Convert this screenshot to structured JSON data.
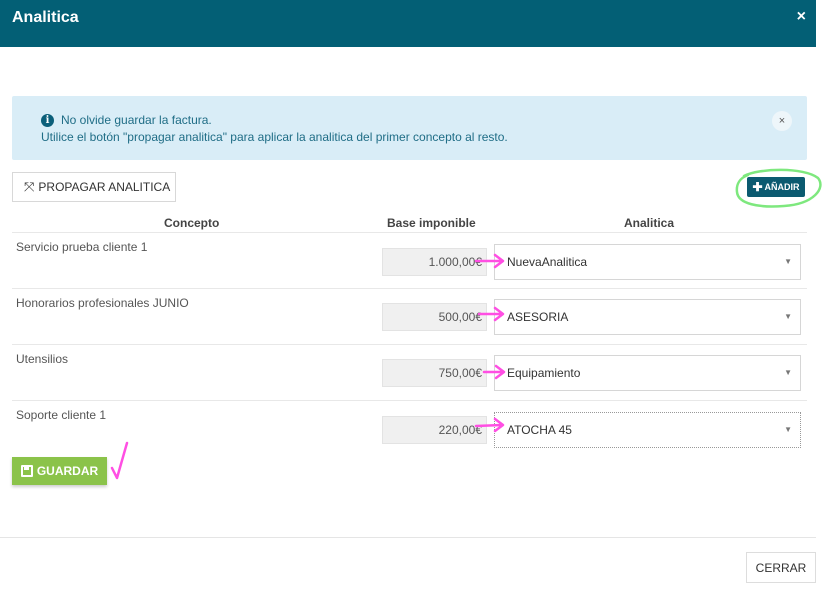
{
  "modal": {
    "title": "Analitica",
    "close_icon": "×"
  },
  "alert": {
    "line1": "No olvide guardar la factura.",
    "line2": "Utilice el botón \"propagar analitica\" para aplicar la analitica del primer concepto al resto.",
    "close_icon": "×"
  },
  "toolbar": {
    "propagar_label": "PROPAGAR ANALITICA",
    "anadir_label": "AÑADIR"
  },
  "table": {
    "headers": [
      "Concepto",
      "Base imponible",
      "Analitica"
    ],
    "rows": [
      {
        "concepto": "Servicio prueba cliente 1",
        "base": "1.000,00€",
        "analitica": "NuevaAnalitica"
      },
      {
        "concepto": "Honorarios profesionales JUNIO",
        "base": "500,00€",
        "analitica": "ASESORIA"
      },
      {
        "concepto": "Utensilios",
        "base": "750,00€",
        "analitica": "Equipamiento"
      },
      {
        "concepto": "Soporte cliente 1",
        "base": "220,00€",
        "analitica": "ATOCHA 45"
      }
    ]
  },
  "actions": {
    "guardar_label": "GUARDAR",
    "cerrar_label": "CERRAR"
  },
  "colors": {
    "header": "#035f75",
    "alert_bg": "#d9edf7",
    "accent_button": "#0b5a70",
    "save_button": "#8bc34a",
    "annotation_green": "#7ee87e",
    "annotation_pink": "#ff4fe3"
  }
}
